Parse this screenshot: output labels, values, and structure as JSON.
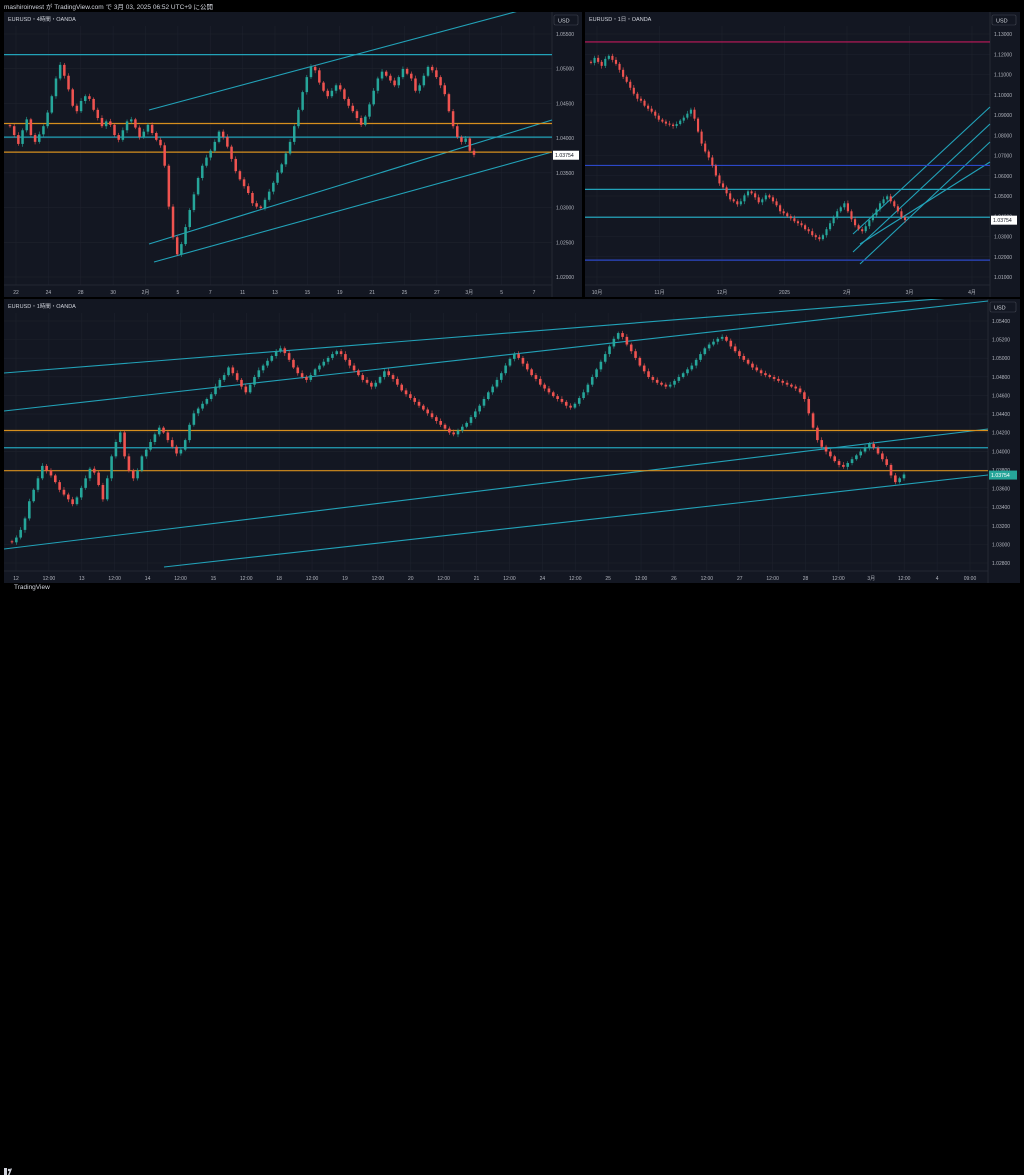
{
  "header": {
    "text": "mashiroinvest が TradingView.com で 3月 03, 2025 06:52 UTC+9 に公開"
  },
  "footer": {
    "brand": "TradingView"
  },
  "colors": {
    "bg": "#131722",
    "grid": "#1e222d",
    "up": "#26a69a",
    "down": "#ef5350",
    "cyan": "#22a2b8",
    "orange": "#d68f1e",
    "blue": "#2c48c8",
    "pink": "#c2185b"
  },
  "panels": {
    "p4h": {
      "title": "EURUSD・4時間・OANDA",
      "currency": "USD",
      "price_label": "1.03754",
      "y_ticks": [
        "1.05500",
        "1.05000",
        "1.04500",
        "1.04000",
        "1.03500",
        "1.03000",
        "1.02500",
        "1.02000"
      ],
      "x_ticks": [
        "22",
        "24",
        "28",
        "30",
        "2月",
        "5",
        "7",
        "11",
        "13",
        "15",
        "19",
        "21",
        "25",
        "27",
        "3月",
        "5",
        "7"
      ]
    },
    "p1d": {
      "title": "EURUSD・1日・OANDA",
      "currency": "USD",
      "price_label": "1.03754",
      "y_ticks": [
        "1.13000",
        "1.12000",
        "1.11000",
        "1.10000",
        "1.09000",
        "1.08000",
        "1.07000",
        "1.06000",
        "1.05000",
        "1.04000",
        "1.03000",
        "1.02000",
        "1.01000"
      ],
      "x_ticks": [
        "10月",
        "11月",
        "12月",
        "2025",
        "2月",
        "3月",
        "4月"
      ]
    },
    "p1h": {
      "title": "EURUSD・1時間・OANDA",
      "currency": "USD",
      "price_label": "1.03754",
      "y_ticks": [
        "1.05400",
        "1.05200",
        "1.05000",
        "1.04800",
        "1.04600",
        "1.04400",
        "1.04200",
        "1.04000",
        "1.03800",
        "1.03600",
        "1.03400",
        "1.03200",
        "1.03000",
        "1.02800"
      ],
      "x_ticks": [
        "12",
        "12:00",
        "13",
        "12:00",
        "14",
        "12:00",
        "15",
        "12:00",
        "18",
        "12:00",
        "19",
        "12:00",
        "20",
        "12:00",
        "21",
        "12:00",
        "24",
        "12:00",
        "25",
        "12:00",
        "26",
        "12:00",
        "27",
        "12:00",
        "28",
        "12:00",
        "3月",
        "12:00",
        "4",
        "09:00"
      ]
    }
  },
  "chart_data": [
    {
      "type": "candlestick",
      "name": "EURUSD 4H",
      "ylim": [
        1.0185,
        1.0565
      ],
      "series": {
        "closes": [
          1.0418,
          1.0405,
          1.0392,
          1.0412,
          1.0428,
          1.0405,
          1.0395,
          1.0406,
          1.0418,
          1.0438,
          1.0462,
          1.0488,
          1.0508,
          1.0492,
          1.0472,
          1.0448,
          1.044,
          1.0455,
          1.0462,
          1.0458,
          1.0442,
          1.043,
          1.0418,
          1.0425,
          1.042,
          1.0405,
          1.0398,
          1.0412,
          1.0425,
          1.0428,
          1.0416,
          1.0402,
          1.041,
          1.042,
          1.0408,
          1.0398,
          1.039,
          1.036,
          1.03,
          1.0255,
          1.023,
          1.0245,
          1.027,
          1.0295,
          1.0318,
          1.0342,
          1.036,
          1.0372,
          1.0382,
          1.0395,
          1.041,
          1.0402,
          1.0388,
          1.037,
          1.0352,
          1.034,
          1.033,
          1.032,
          1.0305,
          1.03,
          1.0298,
          1.031,
          1.0322,
          1.0335,
          1.035,
          1.0362,
          1.0378,
          1.0395,
          1.0418,
          1.0442,
          1.0468,
          1.049,
          1.0505,
          1.05,
          1.0482,
          1.047,
          1.0462,
          1.047,
          1.0478,
          1.0472,
          1.0458,
          1.0448,
          1.044,
          1.043,
          1.042,
          1.0432,
          1.045,
          1.047,
          1.0488,
          1.0498,
          1.0492,
          1.0485,
          1.0478,
          1.049,
          1.0502,
          1.0495,
          1.0488,
          1.047,
          1.0478,
          1.0492,
          1.0505,
          1.05,
          1.049,
          1.0478,
          1.0465,
          1.044,
          1.0418,
          1.0402,
          1.0395,
          1.04,
          1.0382,
          1.0376
        ]
      },
      "levels": {
        "horizontal": [
          1.0523,
          1.0422,
          1.0402,
          1.038
        ],
        "price": 1.03754
      }
    },
    {
      "type": "candlestick",
      "name": "EURUSD 1D",
      "ylim": [
        1.005,
        1.135
      ],
      "series": {
        "closes": [
          1.1165,
          1.119,
          1.117,
          1.115,
          1.1185,
          1.12,
          1.118,
          1.116,
          1.113,
          1.1095,
          1.107,
          1.104,
          1.101,
          1.0985,
          1.0975,
          1.095,
          1.0935,
          1.092,
          1.09,
          1.088,
          1.087,
          1.086,
          1.0855,
          1.0848,
          1.0858,
          1.0875,
          1.089,
          1.091,
          1.093,
          1.0885,
          1.082,
          1.076,
          1.072,
          1.069,
          1.065,
          1.06,
          1.056,
          1.054,
          1.051,
          1.048,
          1.047,
          1.0455,
          1.047,
          1.05,
          1.052,
          1.051,
          1.049,
          1.0465,
          1.048,
          1.05,
          1.049,
          1.047,
          1.045,
          1.042,
          1.041,
          1.0395,
          1.0385,
          1.037,
          1.036,
          1.035,
          1.033,
          1.032,
          1.03,
          1.029,
          1.028,
          1.03,
          1.033,
          1.036,
          1.039,
          1.042,
          1.044,
          1.046,
          1.042,
          1.038,
          1.035,
          1.033,
          1.032,
          1.0345,
          1.0375,
          1.04,
          1.043,
          1.046,
          1.048,
          1.0495,
          1.047,
          1.0445,
          1.042,
          1.039,
          1.0376
        ]
      },
      "levels": {
        "horizontal": [
          1.127,
          1.065,
          1.053,
          1.039,
          1.0175
        ],
        "price": 1.03754
      }
    },
    {
      "type": "candlestick",
      "name": "EURUSD 1H",
      "ylim": [
        1.0275,
        1.0545
      ],
      "series": {
        "closes": [
          1.0305,
          1.031,
          1.0318,
          1.033,
          1.0348,
          1.036,
          1.0372,
          1.0385,
          1.038,
          1.0375,
          1.0368,
          1.036,
          1.0355,
          1.035,
          1.0345,
          1.0352,
          1.0362,
          1.0372,
          1.0382,
          1.0378,
          1.0365,
          1.035,
          1.0372,
          1.0395,
          1.041,
          1.042,
          1.0395,
          1.038,
          1.0372,
          1.038,
          1.0395,
          1.0402,
          1.041,
          1.0418,
          1.0425,
          1.042,
          1.0412,
          1.0405,
          1.0398,
          1.0402,
          1.0412,
          1.0428,
          1.044,
          1.0445,
          1.045,
          1.0455,
          1.046,
          1.0468,
          1.0475,
          1.048,
          1.0488,
          1.0482,
          1.0475,
          1.0468,
          1.0462,
          1.047,
          1.0478,
          1.0485,
          1.049,
          1.0495,
          1.05,
          1.0505,
          1.0508,
          1.0503,
          1.0496,
          1.0488,
          1.0482,
          1.0478,
          1.0475,
          1.048,
          1.0486,
          1.049,
          1.0494,
          1.0498,
          1.0502,
          1.0505,
          1.0502,
          1.0496,
          1.049,
          1.0485,
          1.048,
          1.0475,
          1.0472,
          1.0468,
          1.0472,
          1.0478,
          1.0484,
          1.048,
          1.0476,
          1.047,
          1.0464,
          1.046,
          1.0456,
          1.0452,
          1.0448,
          1.0444,
          1.044,
          1.0436,
          1.0432,
          1.0428,
          1.0424,
          1.042,
          1.0418,
          1.0422,
          1.0426,
          1.043,
          1.0436,
          1.0442,
          1.0448,
          1.0455,
          1.0462,
          1.0468,
          1.0475,
          1.0482,
          1.049,
          1.0497,
          1.0502,
          1.0498,
          1.0492,
          1.0486,
          1.048,
          1.0476,
          1.047,
          1.0466,
          1.0462,
          1.0458,
          1.0455,
          1.0452,
          1.0448,
          1.0446,
          1.045,
          1.0456,
          1.0462,
          1.047,
          1.0478,
          1.0486,
          1.0494,
          1.0502,
          1.051,
          1.0518,
          1.0524,
          1.052,
          1.0512,
          1.0505,
          1.0498,
          1.049,
          1.0484,
          1.0478,
          1.0475,
          1.0472,
          1.047,
          1.0468,
          1.047,
          1.0474,
          1.0478,
          1.0482,
          1.0486,
          1.049,
          1.0496,
          1.0502,
          1.0508,
          1.0512,
          1.0515,
          1.0518,
          1.052,
          1.0516,
          1.051,
          1.0505,
          1.05,
          1.0496,
          1.0492,
          1.0488,
          1.0485,
          1.0482,
          1.048,
          1.0478,
          1.0476,
          1.0474,
          1.0472,
          1.047,
          1.0468,
          1.0466,
          1.0462,
          1.0455,
          1.044,
          1.0425,
          1.0412,
          1.0405,
          1.04,
          1.0395,
          1.039,
          1.0386,
          1.0384,
          1.0388,
          1.0392,
          1.0396,
          1.04,
          1.0404,
          1.0408,
          1.0404,
          1.0398,
          1.0392,
          1.0386,
          1.0375,
          1.0368,
          1.0372,
          1.0376
        ]
      },
      "levels": {
        "horizontal": [
          1.0422,
          1.0404,
          1.038
        ],
        "price": 1.03754
      }
    }
  ]
}
